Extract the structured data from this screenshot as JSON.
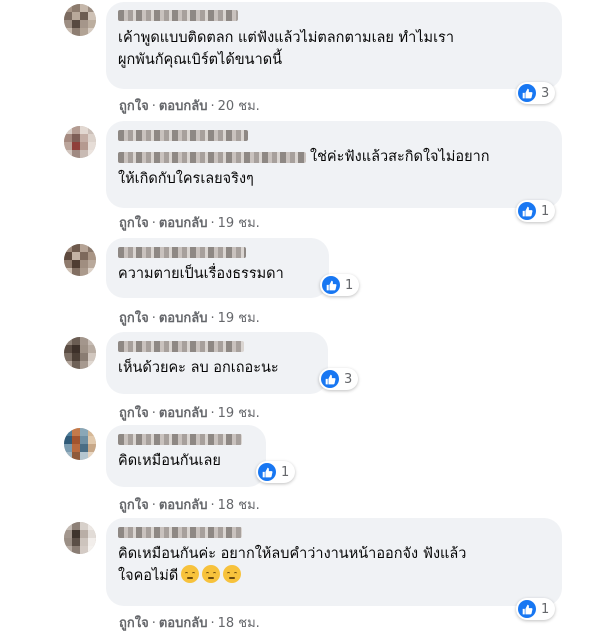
{
  "comments": [
    {
      "text": "เค้าพูดแบบติดตลก แต่ฟังแล้วไม่ตลกตามเลย ทำไมเรา\nผูกพันกัคุณเบิร์ตได้ขนาดนี้",
      "reactions": "3",
      "like": "ถูกใจ",
      "reply": "ตอบกลับ",
      "time": "20 ชม."
    },
    {
      "text": "ใช่ค่ะฟังแล้วสะกิดใจไม่อยาก\nให้เกิดกับใครเลยจริงๆ",
      "reactions": "1",
      "like": "ถูกใจ",
      "reply": "ตอบกลับ",
      "time": "19 ชม."
    },
    {
      "text": "ความตายเป็นเรื่องธรรมดา",
      "reactions": "1",
      "like": "ถูกใจ",
      "reply": "ตอบกลับ",
      "time": "19 ชม."
    },
    {
      "text": "เห็นด้วยคะ ลบ อกเถอะนะ",
      "reactions": "3",
      "like": "ถูกใจ",
      "reply": "ตอบกลับ",
      "time": "19 ชม."
    },
    {
      "text": "คิดเหมือนกันเลย",
      "reactions": "1",
      "like": "ถูกใจ",
      "reply": "ตอบกลับ",
      "time": "18 ชม."
    },
    {
      "text": "คิดเหมือนกันค่ะ อยากให้ลบคำว่างานหน้าออกจัง ฟังแล้ว\nใจคอไม่ดี",
      "reactions": "1",
      "like": "ถูกใจ",
      "reply": "ตอบกลับ",
      "time": "18 ชม."
    }
  ],
  "icons": {
    "reaction": "like-icon",
    "emoji": "pensive-face-emoji"
  },
  "colors": {
    "like_blue": "#1877f2",
    "bubble": "#f0f2f5",
    "meta_gray": "#65676b"
  }
}
